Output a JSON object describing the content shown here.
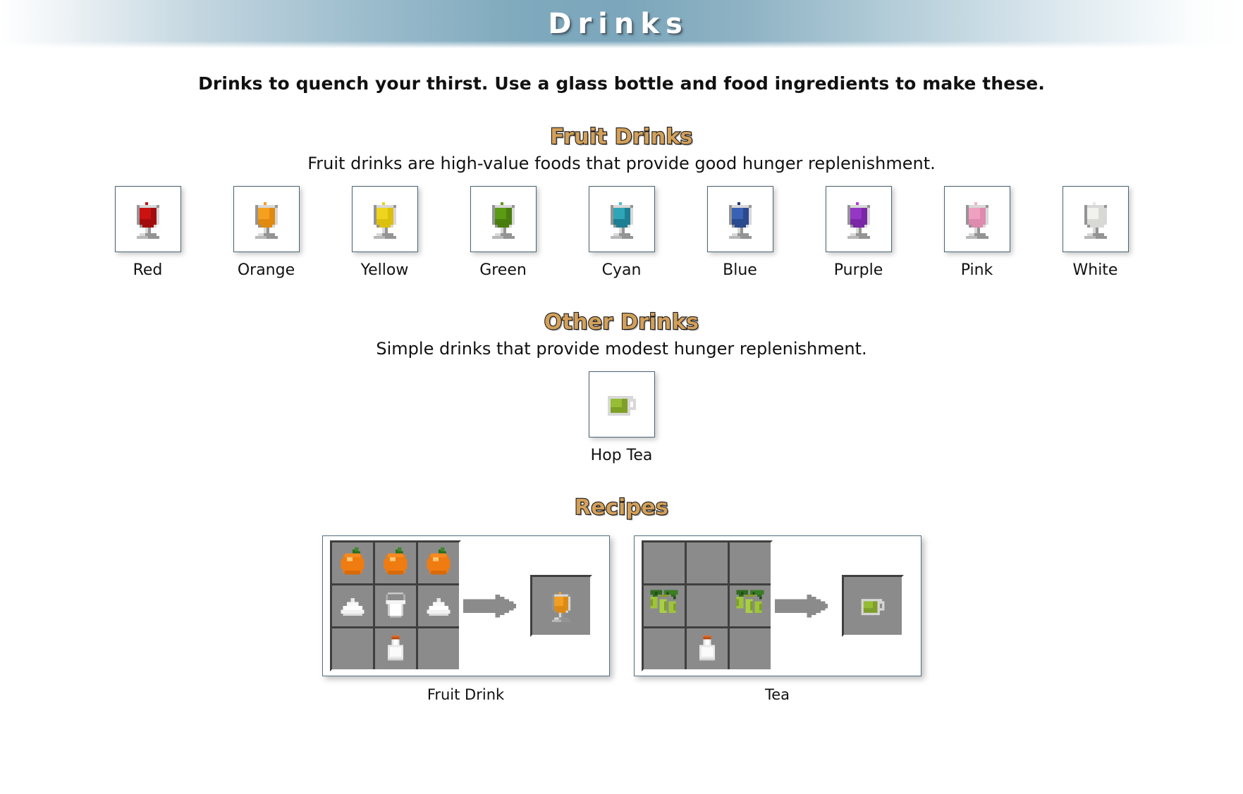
{
  "header": {
    "title": "Drinks"
  },
  "intro": {
    "text": "Drinks to quench your thirst. Use a glass bottle and food ingredients to make these."
  },
  "sections": [
    {
      "id": "fruit-drinks",
      "heading": "Fruit Drinks",
      "subtitle": "Fruit drinks are high-value foods that provide good hunger replenishment.",
      "items": [
        {
          "label": "Red",
          "icon": "drink-glass-icon",
          "liquid": "#cc1111",
          "liquid_dark": "#a10d0d",
          "drop": "#cc1111"
        },
        {
          "label": "Orange",
          "icon": "drink-glass-icon",
          "liquid": "#f5a01e",
          "liquid_dark": "#e08a10",
          "drop": "#f5a01e"
        },
        {
          "label": "Yellow",
          "icon": "drink-glass-icon",
          "liquid": "#eed41c",
          "liquid_dark": "#dcc010",
          "drop": "#eed41c"
        },
        {
          "label": "Green",
          "icon": "drink-glass-icon",
          "liquid": "#5a9a14",
          "liquid_dark": "#497e0f",
          "drop": "#5a9a14"
        },
        {
          "label": "Cyan",
          "icon": "drink-glass-icon",
          "liquid": "#2fa5b8",
          "liquid_dark": "#1d7f92",
          "drop": "#48c0d2"
        },
        {
          "label": "Blue",
          "icon": "drink-glass-icon",
          "liquid": "#3a62b4",
          "liquid_dark": "#2a4a8f",
          "drop": "#1f3473"
        },
        {
          "label": "Purple",
          "icon": "drink-glass-icon",
          "liquid": "#9636c4",
          "liquid_dark": "#7b28a6",
          "drop": "#b43ae0"
        },
        {
          "label": "Pink",
          "icon": "drink-glass-icon",
          "liquid": "#f0a0c0",
          "liquid_dark": "#dd8bae",
          "drop": "#f6aecb"
        },
        {
          "label": "White",
          "icon": "drink-glass-icon",
          "liquid": "#f1f1ee",
          "liquid_dark": "#d8d8d4",
          "drop": "#e8e8e4"
        }
      ]
    },
    {
      "id": "other-drinks",
      "heading": "Other Drinks",
      "subtitle": "Simple drinks that provide modest hunger replenishment.",
      "items": [
        {
          "label": "Hop Tea",
          "icon": "tea-mug-icon",
          "liquid": "#96bd33",
          "liquid_dark": "#7ea026",
          "drop": "#96bd33"
        }
      ]
    }
  ],
  "recipes": {
    "heading": "Recipes",
    "entries": [
      {
        "caption": "Fruit Drink",
        "grid": [
          [
            "orange-fruit-icon",
            "orange-fruit-icon",
            "orange-fruit-icon"
          ],
          [
            "sugar-icon",
            "milk-bucket-icon",
            "sugar-icon"
          ],
          [
            "",
            "glass-bottle-icon",
            ""
          ]
        ],
        "arrow": "arrow-right-icon",
        "result": "orange-drink-icon"
      },
      {
        "caption": "Tea",
        "grid": [
          [
            "",
            "",
            ""
          ],
          [
            "hops-icon",
            "",
            "hops-icon"
          ],
          [
            "",
            "glass-bottle-icon",
            ""
          ]
        ],
        "arrow": "arrow-right-icon",
        "result": "tea-mug-icon"
      }
    ]
  },
  "colors": {
    "heading_fill": "#d3a05a",
    "heading_stroke": "#1b1b1b",
    "header_gradient_mid": "#7ba6bb",
    "box_border": "#4a6472",
    "slot_bg": "#8b8b8b",
    "text": "#111111"
  }
}
